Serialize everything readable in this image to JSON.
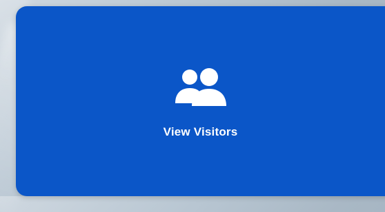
{
  "card": {
    "label": "View Visitors",
    "icon": "users-icon",
    "background_color": "#0b56c8",
    "text_color": "#ffffff"
  }
}
